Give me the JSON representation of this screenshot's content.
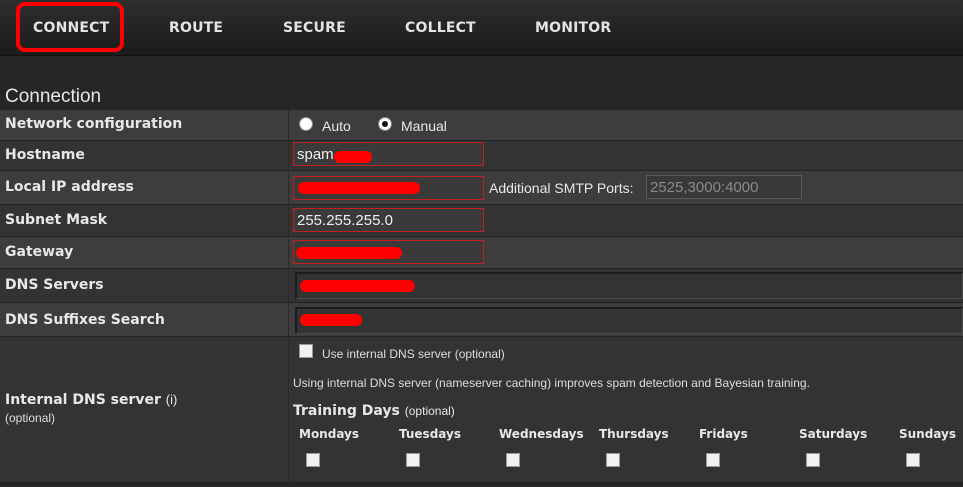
{
  "nav": {
    "items": [
      {
        "label": "CONNECT",
        "active": true
      },
      {
        "label": "ROUTE"
      },
      {
        "label": "SECURE"
      },
      {
        "label": "COLLECT"
      },
      {
        "label": "MONITOR"
      }
    ]
  },
  "section_title": "Connection",
  "network_config": {
    "label": "Network configuration",
    "options": [
      "Auto",
      "Manual"
    ],
    "selected": "Manual"
  },
  "hostname": {
    "label": "Hostname",
    "value": "spam"
  },
  "local_ip": {
    "label": "Local IP address",
    "value": "",
    "smtp_label": "Additional SMTP Ports:",
    "smtp_value": "2525,3000:4000"
  },
  "subnet": {
    "label": "Subnet Mask",
    "value": "255.255.255.0"
  },
  "gateway": {
    "label": "Gateway",
    "value": ""
  },
  "dns_servers": {
    "label": "DNS Servers",
    "value": ""
  },
  "dns_suffixes": {
    "label": "DNS Suffixes Search",
    "value": ""
  },
  "internal_dns": {
    "label": "Internal DNS server",
    "info_glyph": "(i)",
    "sub_label": "(optional)",
    "checkbox_label": "Use internal DNS server (optional)",
    "description": "Using internal DNS server (nameserver caching) improves spam detection and Bayesian training.",
    "training_title": "Training Days",
    "training_optional": "(optional)",
    "days": [
      "Mondays",
      "Tuesdays",
      "Wednesdays",
      "Thursdays",
      "Fridays",
      "Saturdays",
      "Sundays"
    ]
  },
  "colors": {
    "accent_red": "#ff0000",
    "row_dark": "#333333",
    "row_light": "#3d3d3d"
  }
}
